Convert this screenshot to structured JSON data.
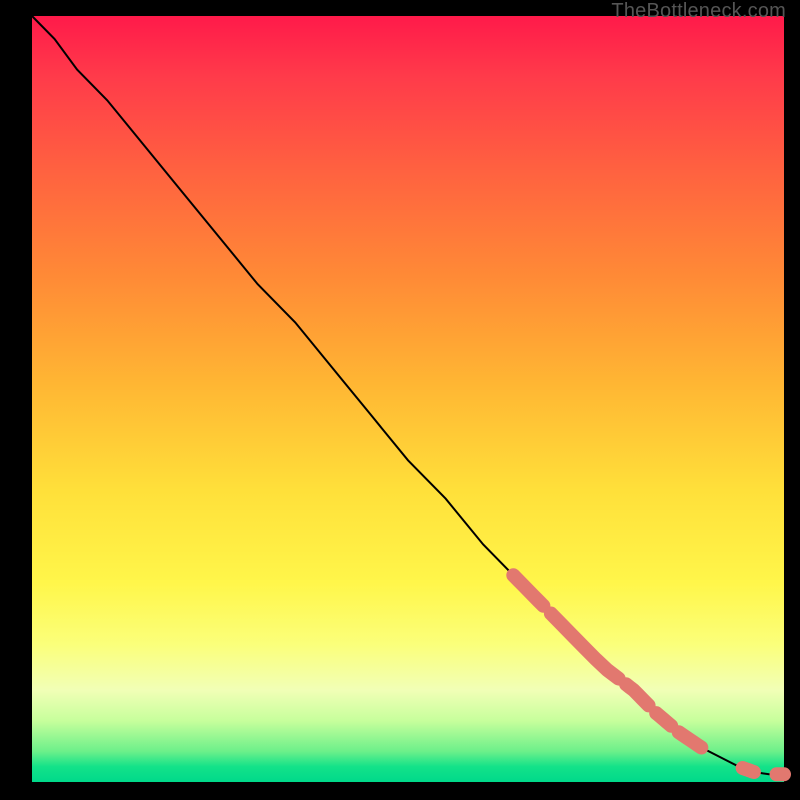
{
  "watermark": "TheBottleneck.com",
  "colors": {
    "marker": "#e2786f",
    "line": "#000000"
  },
  "chart_data": {
    "type": "line",
    "title": "",
    "xlabel": "",
    "ylabel": "",
    "xlim": [
      0,
      100
    ],
    "ylim": [
      0,
      100
    ],
    "grid": false,
    "legend": false,
    "series": [
      {
        "name": "curve",
        "x": [
          0,
          3,
          6,
          10,
          15,
          20,
          25,
          30,
          35,
          40,
          45,
          50,
          55,
          60,
          64,
          68,
          72,
          76,
          80,
          83,
          86,
          89,
          92,
          94,
          96,
          98,
          100
        ],
        "y": [
          100,
          97,
          93,
          89,
          83,
          77,
          71,
          65,
          60,
          54,
          48,
          42,
          37,
          31,
          27,
          23,
          19,
          15,
          12,
          9,
          6.5,
          4.5,
          3,
          2,
          1.3,
          1,
          1
        ]
      }
    ],
    "highlight_regions": [
      {
        "x_start": 64,
        "x_end": 68
      },
      {
        "x_start": 69,
        "x_end": 78
      },
      {
        "x_start": 79,
        "x_end": 82
      },
      {
        "x_start": 83,
        "x_end": 85
      },
      {
        "x_start": 86,
        "x_end": 89
      },
      {
        "x_start": 94.5,
        "x_end": 96
      },
      {
        "x_start": 99,
        "x_end": 100
      }
    ]
  }
}
